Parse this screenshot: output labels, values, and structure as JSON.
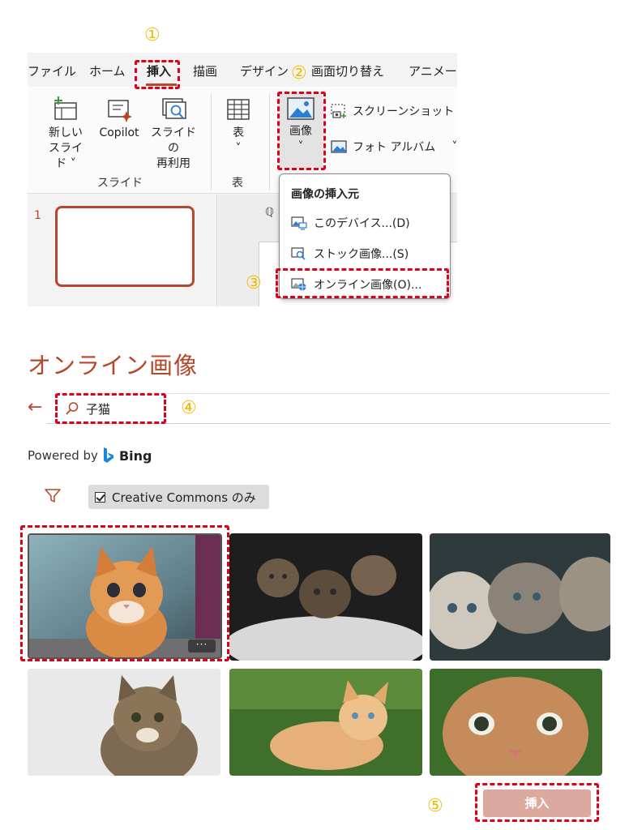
{
  "steps": [
    "①",
    "②",
    "③",
    "④",
    "⑤"
  ],
  "ribbon": {
    "tabs": [
      "ファイル",
      "ホーム",
      "挿入",
      "描画",
      "デザイン",
      "画面切り替え",
      "アニメーシ"
    ],
    "active_tab": "挿入",
    "buttons": {
      "new_slide": [
        "新しい",
        "スライド ˅"
      ],
      "copilot": "Copilot",
      "reuse_slides": [
        "スライドの",
        "再利用"
      ],
      "table": [
        "表",
        "˅"
      ],
      "image": [
        "画像",
        "˅"
      ],
      "screenshot": "スクリーンショット ˅",
      "photo_album": "フォト アルバム"
    },
    "group_labels": {
      "slides": "スライド",
      "table": "表"
    },
    "slide_number": "1"
  },
  "dropdown": {
    "title": "画像の挿入元",
    "items": [
      "このデバイス...(D)",
      "ストック画像...(S)",
      "オンライン画像(O)..."
    ]
  },
  "dialog": {
    "title": "オンライン画像",
    "back": "←",
    "search_value": "子猫",
    "powered_by": "Powered by",
    "bing": "Bing",
    "cc_label": "Creative Commons のみ",
    "more": "···",
    "insert": "挿入",
    "images": [
      "kitten-orange-sitting",
      "kittens-group-blanket",
      "kittens-tabby-row",
      "kitten-tabby-portrait",
      "kitten-grass-lying",
      "kitten-closeup"
    ]
  },
  "colors": {
    "accent": "#b7472a",
    "step_marker": "#f5b800",
    "highlight": "#e0001a",
    "insert_disabled": "#dba99d"
  }
}
